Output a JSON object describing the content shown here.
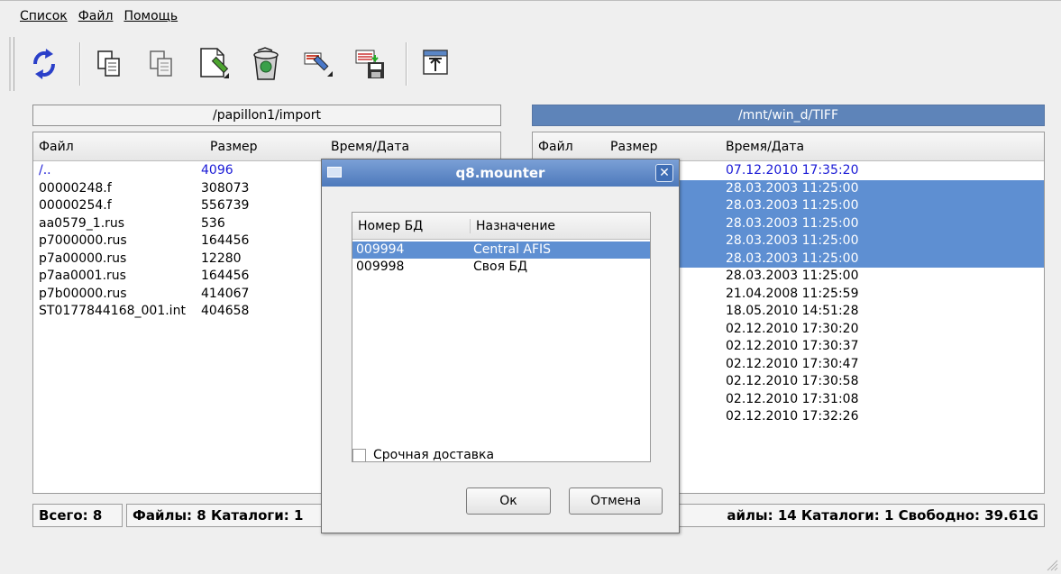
{
  "menu": [
    {
      "label": "Список",
      "underline": "С"
    },
    {
      "label": "Файл",
      "underline": "Ф"
    },
    {
      "label": "Помощь",
      "underline": "П"
    }
  ],
  "toolbar": {
    "buttons": [
      {
        "name": "refresh-icon"
      },
      {
        "name": "copy-icon"
      },
      {
        "name": "copy-disabled-icon"
      },
      {
        "name": "edit-document-icon"
      },
      {
        "name": "recycle-bin-icon"
      },
      {
        "name": "move-tool-icon"
      },
      {
        "name": "save-transfer-icon"
      },
      {
        "name": "export-up-icon"
      }
    ]
  },
  "left_panel": {
    "path": "/papillon1/import",
    "headers": [
      "Файл",
      "Размер",
      "Время/Дата"
    ],
    "rows": [
      {
        "name": "/..",
        "size": "4096",
        "date": ""
      },
      {
        "name": "00000248.f",
        "size": "308073",
        "date": ""
      },
      {
        "name": "00000254.f",
        "size": "556739",
        "date": ""
      },
      {
        "name": "aa0579_1.rus",
        "size": "536",
        "date": ""
      },
      {
        "name": "p7000000.rus",
        "size": "164456",
        "date": ""
      },
      {
        "name": "p7a00000.rus",
        "size": "12280",
        "date": ""
      },
      {
        "name": "p7aa0001.rus",
        "size": "164456",
        "date": ""
      },
      {
        "name": "p7b00000.rus",
        "size": "414067",
        "date": ""
      },
      {
        "name": "ST0177844168_001.int",
        "size": "404658",
        "date": ""
      }
    ],
    "status_total": "Всего: 8",
    "status_detail": "Файлы: 8 Каталоги: 1"
  },
  "right_panel": {
    "path": "/mnt/win_d/TIFF",
    "headers": [
      "Файл",
      "Размер",
      "Время/Дата"
    ],
    "rows": [
      {
        "date": "07.12.2010 17:35:20",
        "state": "blue"
      },
      {
        "date": "28.03.2003 11:25:00",
        "state": "selected"
      },
      {
        "date": "28.03.2003 11:25:00",
        "state": "selected"
      },
      {
        "date": "28.03.2003 11:25:00",
        "state": "selected"
      },
      {
        "date": "28.03.2003 11:25:00",
        "state": "selected"
      },
      {
        "date": "28.03.2003 11:25:00",
        "state": "selected"
      },
      {
        "date": "28.03.2003 11:25:00",
        "state": "normal"
      },
      {
        "date": "21.04.2008 11:25:59",
        "state": "normal"
      },
      {
        "date": "18.05.2010 14:51:28",
        "state": "normal"
      },
      {
        "date": "02.12.2010 17:30:20",
        "state": "normal"
      },
      {
        "date": "02.12.2010 17:30:37",
        "state": "normal"
      },
      {
        "date": "02.12.2010 17:30:47",
        "state": "normal"
      },
      {
        "date": "02.12.2010 17:30:58",
        "state": "normal"
      },
      {
        "date": "02.12.2010 17:31:08",
        "state": "normal"
      },
      {
        "date": "02.12.2010 17:32:26",
        "state": "normal"
      }
    ],
    "status_detail": "айлы: 14 Каталоги: 1 Свободно: 39.61G"
  },
  "dialog": {
    "title": "q8.mounter",
    "headers": [
      "Номер БД",
      "Назначение"
    ],
    "rows": [
      {
        "id": "009994",
        "purpose": "Central AFIS",
        "selected": true
      },
      {
        "id": "009998",
        "purpose": "Своя БД",
        "selected": false
      }
    ],
    "checkbox_label": "Срочная доставка",
    "checkbox_checked": false,
    "ok_label": "Ок",
    "cancel_label": "Отмена"
  },
  "colors": {
    "selection": "#5e8fd2",
    "title_bar": "#4d79bb",
    "path_active": "#5e84b9",
    "link_blue": "#1a1ad6"
  }
}
